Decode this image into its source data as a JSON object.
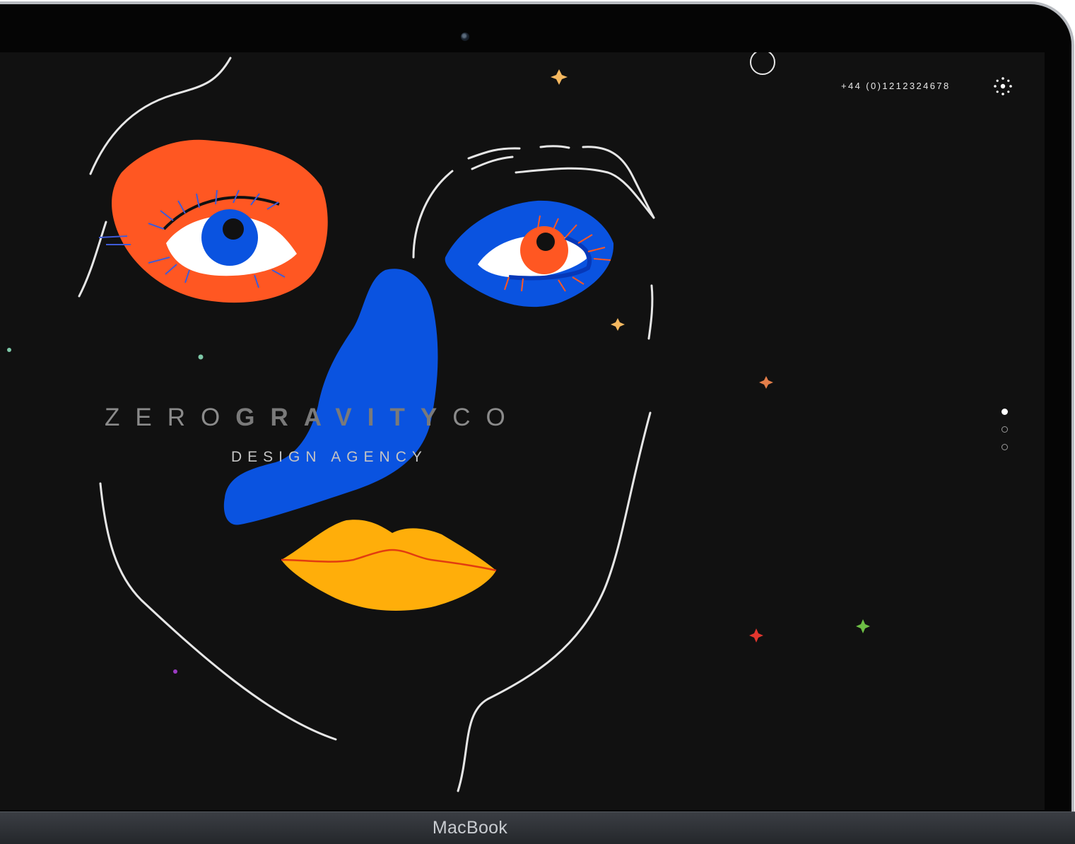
{
  "device": {
    "brand_label": "MacBook"
  },
  "site": {
    "phone": "+44 (0)1212324678",
    "title_light_1": "ZERO",
    "title_bold": "GRAVITY",
    "title_light_2": "CO",
    "subtitle": "DESIGN AGENCY"
  },
  "nav": {
    "menu_icon": "dots-menu-icon",
    "pager": {
      "count": 3,
      "active_index": 0
    }
  },
  "colors": {
    "screen_bg": "#111111",
    "orange": "#FF5722",
    "blue": "#0A53E0",
    "yellow": "#FFAE0A",
    "line": "#E6E6E6"
  }
}
